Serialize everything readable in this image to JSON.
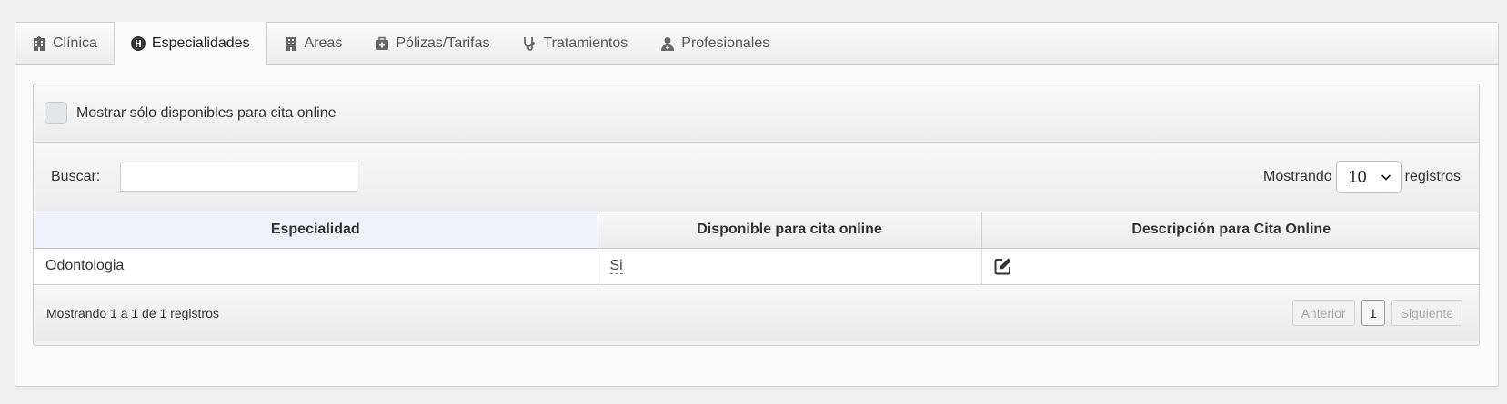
{
  "tabs": [
    {
      "label": "Clínica",
      "icon": "hospital-building-icon"
    },
    {
      "label": "Especialidades",
      "icon": "hospital-h-icon"
    },
    {
      "label": "Areas",
      "icon": "building-icon"
    },
    {
      "label": "Pólizas/Tarifas",
      "icon": "medkit-icon"
    },
    {
      "label": "Tratamientos",
      "icon": "stethoscope-icon"
    },
    {
      "label": "Profesionales",
      "icon": "user-md-icon"
    }
  ],
  "active_tab_index": 1,
  "filter": {
    "label": "Mostrar sólo disponibles para cita online",
    "checked": false
  },
  "search": {
    "label": "Buscar:",
    "value": ""
  },
  "length": {
    "prefix": "Mostrando",
    "value": "10",
    "suffix": "registros"
  },
  "table": {
    "columns": [
      "Especialidad",
      "Disponible para cita online",
      "Descripción para Cita Online"
    ],
    "rows": [
      {
        "especialidad": "Odontologia",
        "disponible": "Si",
        "descripcion_icon": "edit-icon"
      }
    ]
  },
  "footer": {
    "info": "Mostrando 1 a 1 de 1 registros",
    "prev_label": "Anterior",
    "page": "1",
    "next_label": "Siguiente"
  }
}
